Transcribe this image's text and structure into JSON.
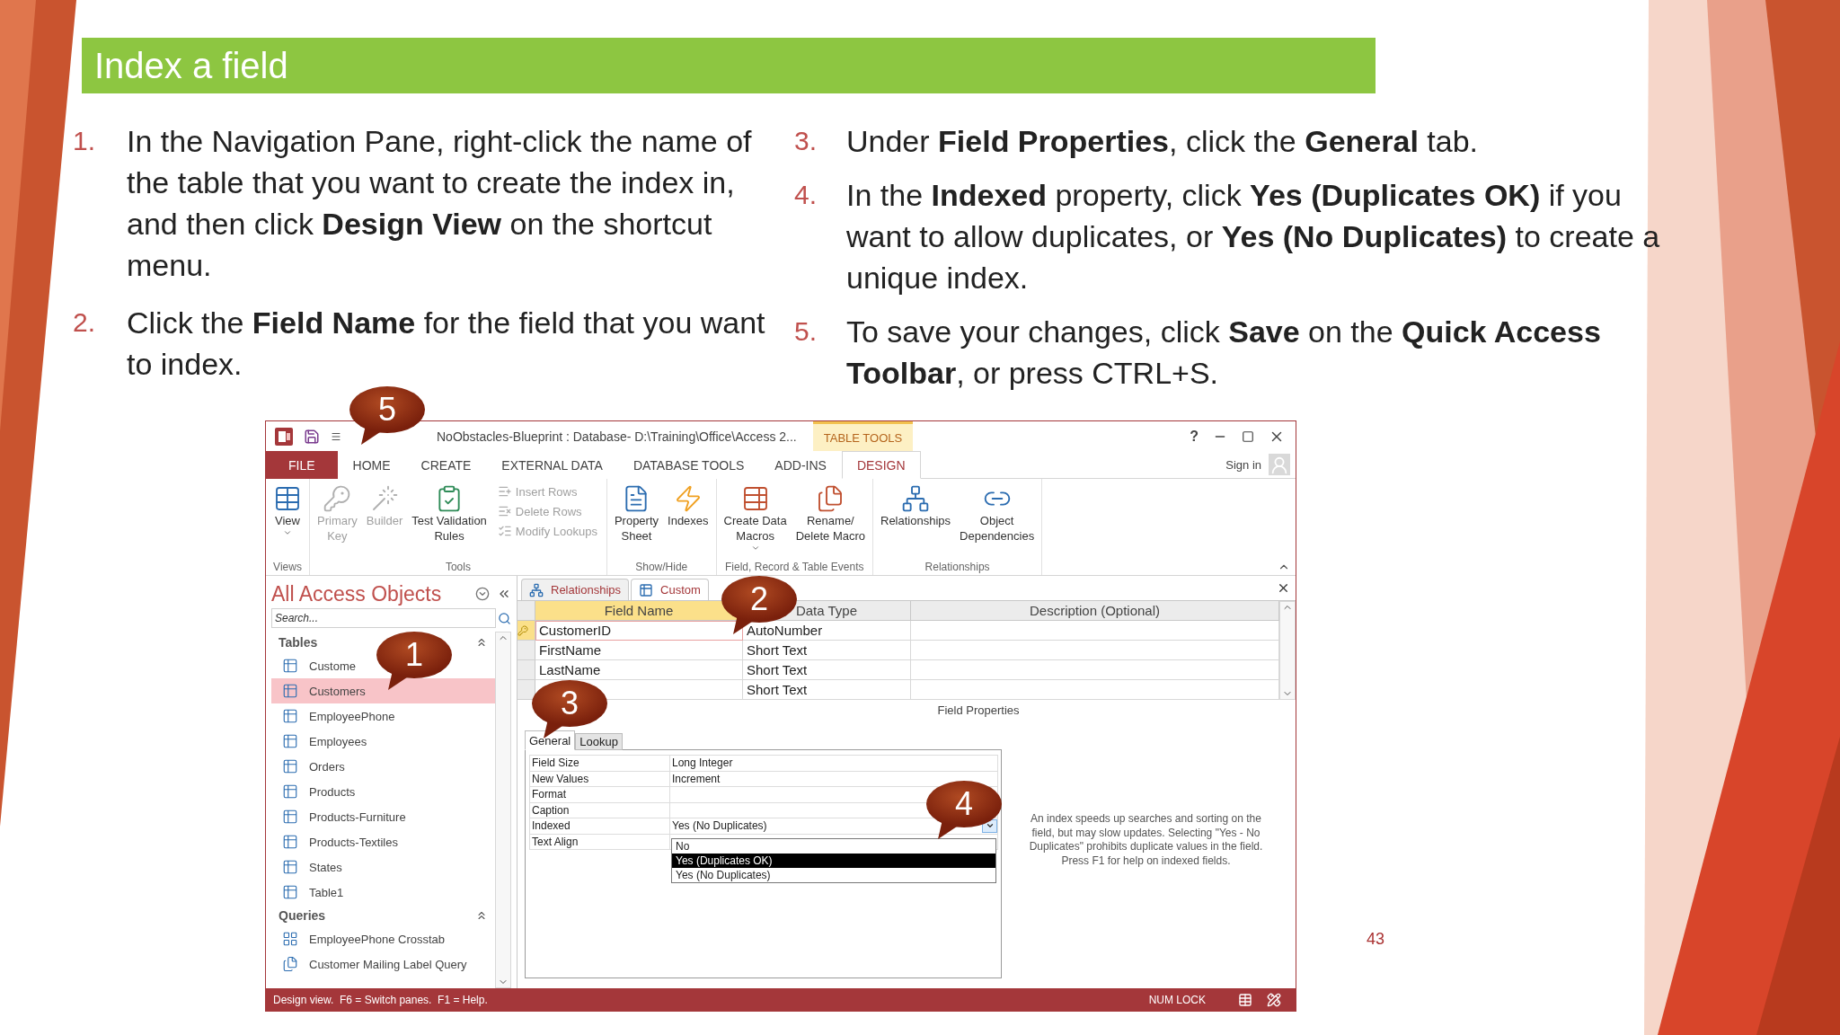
{
  "slide": {
    "title": "Index a field",
    "page_number": "43",
    "steps_left": [
      {
        "number": "1.",
        "text": "In the Navigation Pane, right-click the name of the table that you want to create the index in, and then click **Design View** on the shortcut menu."
      },
      {
        "number": "2.",
        "text": "Click the **Field Name** for the field that you want to index."
      }
    ],
    "steps_right": [
      {
        "number": "3.",
        "text": "Under **Field Properties**, click the **General** tab."
      },
      {
        "number": "4.",
        "text": "In the **Indexed** property, click **Yes (Duplicates OK)** if you want to allow duplicates, or **Yes (No Duplicates)** to create a unique index."
      },
      {
        "number": "5.",
        "text": "To save your changes, click **Save** on the **Quick Access Toolbar**, or press CTRL+S."
      }
    ]
  },
  "window": {
    "title": "NoObstacles-Blueprint : Database- D:\\Training\\Office\\Access 2...",
    "context_tab": "TABLE TOOLS",
    "help": "?",
    "sign_in": "Sign in",
    "ribbon_tabs": [
      {
        "label": "FILE",
        "kind": "file",
        "selected": false
      },
      {
        "label": "HOME",
        "kind": "tab",
        "selected": false
      },
      {
        "label": "CREATE",
        "kind": "tab",
        "selected": false
      },
      {
        "label": "EXTERNAL DATA",
        "kind": "tab",
        "selected": false
      },
      {
        "label": "DATABASE TOOLS",
        "kind": "tab",
        "selected": false
      },
      {
        "label": "ADD-INS",
        "kind": "tab",
        "selected": false
      },
      {
        "label": "DESIGN",
        "kind": "tab",
        "selected": true
      }
    ],
    "ribbon_groups": [
      {
        "label": "Views",
        "buttons": [
          {
            "kind": "large",
            "lines": [
              "View"
            ],
            "disabled": false,
            "dropdown": true
          }
        ]
      },
      {
        "label": "Tools",
        "buttons": [
          {
            "kind": "large",
            "lines": [
              "Primary",
              "Key"
            ],
            "disabled": true
          },
          {
            "kind": "large",
            "lines": [
              "Builder"
            ],
            "disabled": true
          },
          {
            "kind": "large",
            "lines": [
              "Test Validation",
              "Rules"
            ],
            "disabled": false
          },
          {
            "kind": "small",
            "lines": [
              "Insert Rows"
            ],
            "disabled": true
          },
          {
            "kind": "small",
            "lines": [
              "Delete Rows"
            ],
            "disabled": true
          },
          {
            "kind": "small",
            "lines": [
              "Modify Lookups"
            ],
            "disabled": true
          }
        ]
      },
      {
        "label": "Show/Hide",
        "buttons": [
          {
            "kind": "large",
            "lines": [
              "Property",
              "Sheet"
            ],
            "disabled": false
          },
          {
            "kind": "large",
            "lines": [
              "Indexes"
            ],
            "disabled": false
          }
        ]
      },
      {
        "label": "Field, Record & Table Events",
        "buttons": [
          {
            "kind": "large",
            "lines": [
              "Create Data",
              "Macros"
            ],
            "disabled": false,
            "dropdown": true
          },
          {
            "kind": "large",
            "lines": [
              "Rename/",
              "Delete Macro"
            ],
            "disabled": false
          }
        ]
      },
      {
        "label": "Relationships",
        "buttons": [
          {
            "kind": "large",
            "lines": [
              "Relationships"
            ],
            "disabled": false
          },
          {
            "kind": "large",
            "lines": [
              "Object",
              "Dependencies"
            ],
            "disabled": false
          }
        ]
      }
    ],
    "nav": {
      "title": "All Access Objects",
      "search_placeholder": "Search...",
      "sections": [
        {
          "label": "Tables",
          "items": [
            {
              "label": "Custome",
              "kind": "table",
              "selected": false
            },
            {
              "label": "Customers",
              "kind": "table",
              "selected": true
            },
            {
              "label": "EmployeePhone",
              "kind": "table",
              "selected": false
            },
            {
              "label": "Employees",
              "kind": "table",
              "selected": false
            },
            {
              "label": "Orders",
              "kind": "table",
              "selected": false
            },
            {
              "label": "Products",
              "kind": "table",
              "selected": false
            },
            {
              "label": "Products-Furniture",
              "kind": "table",
              "selected": false
            },
            {
              "label": "Products-Textiles",
              "kind": "table",
              "selected": false
            },
            {
              "label": "States",
              "kind": "table",
              "selected": false
            },
            {
              "label": "Table1",
              "kind": "table",
              "selected": false
            }
          ]
        },
        {
          "label": "Queries",
          "items": [
            {
              "label": "EmployeePhone Crosstab",
              "kind": "crosstab",
              "selected": false
            },
            {
              "label": "Customer Mailing Label Query",
              "kind": "query",
              "selected": false
            }
          ]
        }
      ]
    },
    "doc_tabs": [
      {
        "label": "Relationships",
        "kind": "relationships",
        "selected": false
      },
      {
        "label": "Custom",
        "kind": "table",
        "selected": true
      }
    ],
    "grid": {
      "columns": [
        {
          "label": "Field Name",
          "selected": true
        },
        {
          "label": "Data Type",
          "selected": false
        },
        {
          "label": "Description (Optional)",
          "selected": false
        }
      ],
      "rows": [
        {
          "field_name": "CustomerID",
          "data_type": "AutoNumber",
          "selected": true,
          "primary_key": true
        },
        {
          "field_name": "FirstName",
          "data_type": "Short Text",
          "selected": false,
          "primary_key": false
        },
        {
          "field_name": "LastName",
          "data_type": "Short Text",
          "selected": false,
          "primary_key": false
        },
        {
          "data_type": "Short Text",
          "selected": false,
          "primary_key": false
        }
      ]
    },
    "field_properties": {
      "label": "Field Properties",
      "tabs": [
        {
          "label": "General",
          "selected": true
        },
        {
          "label": "Lookup",
          "selected": false
        }
      ],
      "rows": [
        {
          "name": "Field Size",
          "value": "Long Integer",
          "kind": "text"
        },
        {
          "name": "New Values",
          "value": "Increment",
          "kind": "text"
        },
        {
          "name": "Format",
          "kind": "text"
        },
        {
          "name": "Caption",
          "kind": "text"
        },
        {
          "name": "Indexed",
          "value": "Yes (No Duplicates)",
          "kind": "dropdown"
        },
        {
          "name": "Text Align",
          "kind": "text"
        }
      ],
      "options": [
        {
          "label": "No",
          "selected": false
        },
        {
          "label": "Yes (Duplicates OK)",
          "selected": true
        },
        {
          "label": "Yes (No Duplicates)",
          "selected": false
        }
      ],
      "help": "An index speeds up searches and sorting on the field, but may slow updates. Selecting \"Yes - No Duplicates\" prohibits duplicate values in the field. Press F1 for help on indexed fields."
    },
    "status_bar": {
      "text": "Design view.  F6 = Switch panes.  F1 = Help.",
      "num_lock": "NUM LOCK"
    }
  },
  "callouts": [
    "1",
    "2",
    "3",
    "4",
    "5"
  ]
}
